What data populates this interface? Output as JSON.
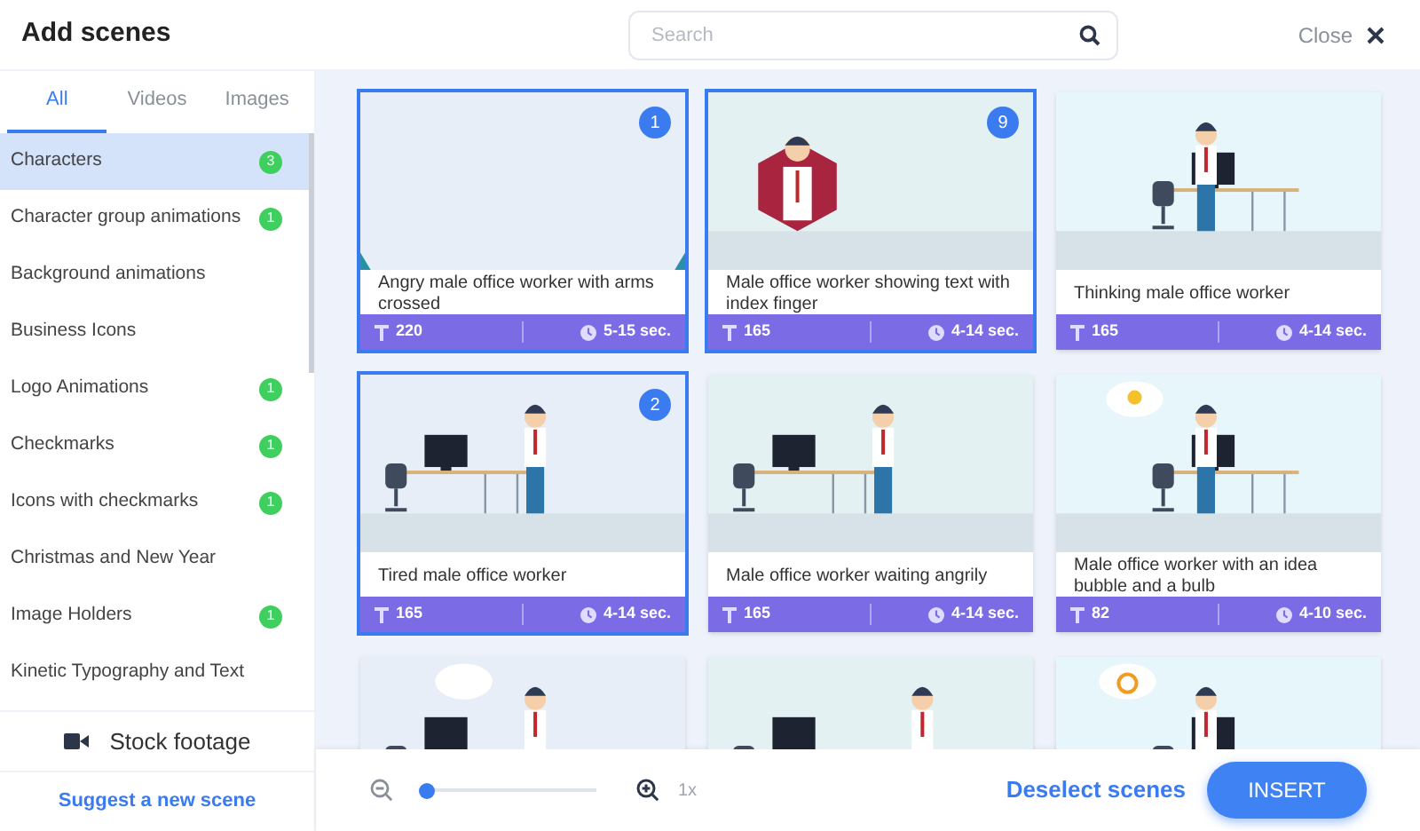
{
  "header": {
    "title": "Add scenes",
    "search": {
      "placeholder": "Search"
    },
    "close": "Close"
  },
  "tabs": [
    {
      "label": "All",
      "selected": true
    },
    {
      "label": "Videos",
      "selected": false
    },
    {
      "label": "Images",
      "selected": false
    }
  ],
  "categories": [
    {
      "label": "Characters",
      "count": "3",
      "selected": true
    },
    {
      "label": "Character group animations",
      "count": "1",
      "selected": false
    },
    {
      "label": "Background animations",
      "selected": false
    },
    {
      "label": "Business Icons",
      "selected": false
    },
    {
      "label": "Logo Animations",
      "count": "1",
      "selected": false
    },
    {
      "label": "Checkmarks",
      "count": "1",
      "selected": false
    },
    {
      "label": "Icons with checkmarks",
      "count": "1",
      "selected": false
    },
    {
      "label": "Christmas and New Year",
      "selected": false
    },
    {
      "label": "Image Holders",
      "count": "1",
      "selected": false
    },
    {
      "label": "Kinetic Typography and Text",
      "selected": false
    }
  ],
  "stock_footage": "Stock footage",
  "suggest_link": "Suggest a new scene",
  "scenes": [
    {
      "kind": "picture",
      "title": "Angry male office worker with arms crossed",
      "characters": "220",
      "duration": "5-15 sec.",
      "selected": true,
      "order": "1"
    },
    {
      "kind": "picture",
      "title": "Male office worker showing text with index finger",
      "characters": "165",
      "duration": "4-14 sec.",
      "selected": true,
      "order": "9"
    },
    {
      "kind": "picture",
      "title": "Thinking male office worker",
      "characters": "165",
      "duration": "4-14 sec.",
      "selected": false
    },
    {
      "kind": "picture",
      "title": "Tired male office worker",
      "characters": "165",
      "duration": "4-14 sec.",
      "selected": true,
      "order": "2"
    },
    {
      "kind": "picture",
      "title": "Male office worker waiting angrily",
      "characters": "165",
      "duration": "4-14 sec.",
      "selected": false
    },
    {
      "kind": "picture",
      "title": "Male office worker with an idea bubble and a bulb",
      "characters": "82",
      "duration": "4-10 sec.",
      "selected": false
    },
    {
      "kind": "picture",
      "selected": false
    },
    {
      "kind": "picture",
      "selected": false
    },
    {
      "kind": "picture",
      "selected": false
    }
  ],
  "zoom": {
    "level": 0,
    "reading": "1x"
  },
  "deselect": "Deselect scenes",
  "insert": "INSERT"
}
